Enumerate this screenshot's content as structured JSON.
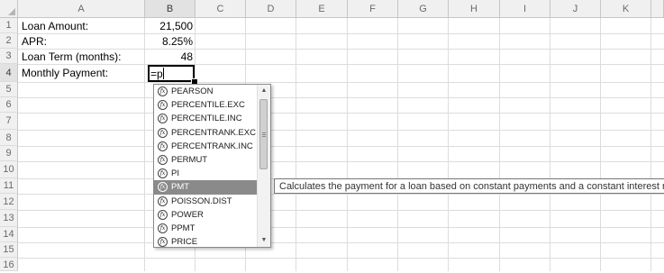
{
  "columns": [
    "A",
    "B",
    "C",
    "D",
    "E",
    "F",
    "G",
    "H",
    "I",
    "J",
    "K"
  ],
  "rows": [
    "1",
    "2",
    "3",
    "4",
    "5",
    "6",
    "7",
    "8",
    "9",
    "10",
    "11",
    "12",
    "13",
    "14",
    "15",
    "16"
  ],
  "cells": {
    "r1": {
      "label": "Loan Amount:",
      "value": "21,500"
    },
    "r2": {
      "label": "APR:",
      "value": "8.25%"
    },
    "r3": {
      "label": "Loan Term (months):",
      "value": "48"
    },
    "r4": {
      "label": "Monthly Payment:",
      "value": "=p"
    }
  },
  "autocomplete": {
    "items": [
      "PEARSON",
      "PERCENTILE.EXC",
      "PERCENTILE.INC",
      "PERCENTRANK.EXC",
      "PERCENTRANK.INC",
      "PERMUT",
      "PI",
      "PMT",
      "POISSON.DIST",
      "POWER",
      "PPMT",
      "PRICE"
    ],
    "selected": "PMT",
    "fx_glyph": "fx",
    "tooltip": "Calculates the payment for a loan based on constant payments and a constant interest rate"
  },
  "icons": {
    "function": "function-icon",
    "scroll_up": "scroll-up-icon",
    "scroll_down": "scroll-down-icon"
  },
  "colors": {
    "header_bg": "#f0f0f0",
    "gridline": "#dcdcdc",
    "highlight": "#8a8a8a"
  }
}
